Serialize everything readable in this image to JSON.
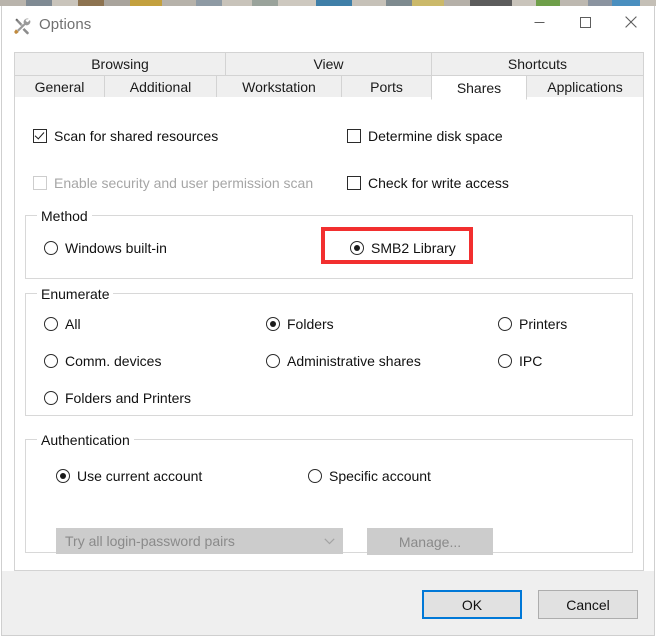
{
  "window": {
    "title": "Options",
    "icon": "tools-icon",
    "controls": {
      "minimize": "minimize-icon",
      "maximize": "maximize-icon",
      "close": "close-icon"
    }
  },
  "tabs": {
    "row1": [
      {
        "label": "Browsing",
        "selected": false
      },
      {
        "label": "View",
        "selected": false
      },
      {
        "label": "Shortcuts",
        "selected": false
      }
    ],
    "row2": [
      {
        "label": "General",
        "selected": false
      },
      {
        "label": "Additional",
        "selected": false
      },
      {
        "label": "Workstation",
        "selected": false
      },
      {
        "label": "Ports",
        "selected": false
      },
      {
        "label": "Shares",
        "selected": true
      },
      {
        "label": "Applications",
        "selected": false
      }
    ],
    "active": "Shares"
  },
  "shares": {
    "checkboxes": [
      {
        "label": "Scan for shared resources",
        "checked": true,
        "disabled": false
      },
      {
        "label": "Determine disk space",
        "checked": false,
        "disabled": false
      },
      {
        "label": "Enable security and user permission scan",
        "checked": false,
        "disabled": true
      },
      {
        "label": "Check for write access",
        "checked": false,
        "disabled": false
      }
    ],
    "method": {
      "title": "Method",
      "options": [
        {
          "label": "Windows built-in",
          "selected": false
        },
        {
          "label": "SMB2 Library",
          "selected": true
        }
      ],
      "highlighted_option": "SMB2 Library"
    },
    "enumerate": {
      "title": "Enumerate",
      "options": [
        {
          "label": "All",
          "selected": false
        },
        {
          "label": "Folders",
          "selected": true
        },
        {
          "label": "Printers",
          "selected": false
        },
        {
          "label": "Comm. devices",
          "selected": false
        },
        {
          "label": "Administrative shares",
          "selected": false
        },
        {
          "label": "IPC",
          "selected": false
        },
        {
          "label": "Folders and Printers",
          "selected": false
        }
      ]
    },
    "authentication": {
      "title": "Authentication",
      "options": [
        {
          "label": "Use current account",
          "selected": true
        },
        {
          "label": "Specific account",
          "selected": false
        }
      ],
      "credentials_combo": {
        "value": "Try all login-password pairs",
        "disabled": true,
        "arrow": "chevron-down-icon"
      },
      "manage_button": {
        "label": "Manage...",
        "disabled": true
      }
    }
  },
  "footer": {
    "ok_label": "OK",
    "cancel_label": "Cancel"
  },
  "colors": {
    "highlight": "#f22f2f",
    "focus": "#0078d7",
    "disabled_text": "#a6a6a6",
    "tab_bg": "#efefef"
  }
}
